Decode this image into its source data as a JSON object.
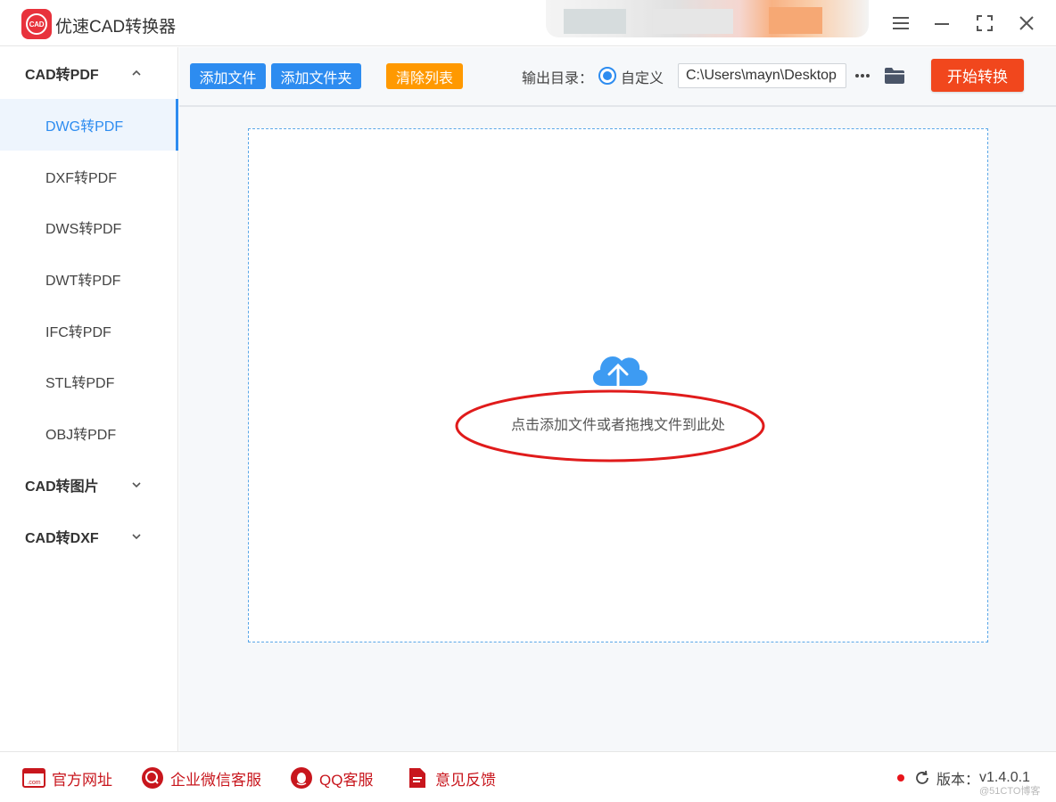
{
  "app": {
    "title": "优速CAD转换器",
    "logo_text": "CAD"
  },
  "sidebar": {
    "groups": [
      {
        "label": "CAD转PDF",
        "expanded": true,
        "items": [
          "DWG转PDF",
          "DXF转PDF",
          "DWS转PDF",
          "DWT转PDF",
          "IFC转PDF",
          "STL转PDF",
          "OBJ转PDF"
        ]
      },
      {
        "label": "CAD转图片",
        "expanded": false
      },
      {
        "label": "CAD转DXF",
        "expanded": false
      }
    ],
    "active_item": "DWG转PDF"
  },
  "toolbar": {
    "add_file": "添加文件",
    "add_folder": "添加文件夹",
    "clear_list": "清除列表",
    "output_label": "输出目录：",
    "radio_custom": "自定义",
    "output_path": "C:\\Users\\mayn\\Desktop",
    "more": "···",
    "start": "开始转换"
  },
  "dropzone": {
    "hint": "点击添加文件或者拖拽文件到此处",
    "icon": "cloud-upload-icon"
  },
  "footer": {
    "website": "官方网址",
    "wechat": "企业微信客服",
    "qq": "QQ客服",
    "feedback": "意见反馈",
    "version_label": "版本：",
    "version": "v1.4.0.1",
    "watermark": "@51CTO博客"
  },
  "colors": {
    "primary": "#2d8cf0",
    "warning": "#ff9900",
    "start": "#f1471d",
    "footer_link": "#c8161d",
    "annotation": "#e01b1b"
  }
}
